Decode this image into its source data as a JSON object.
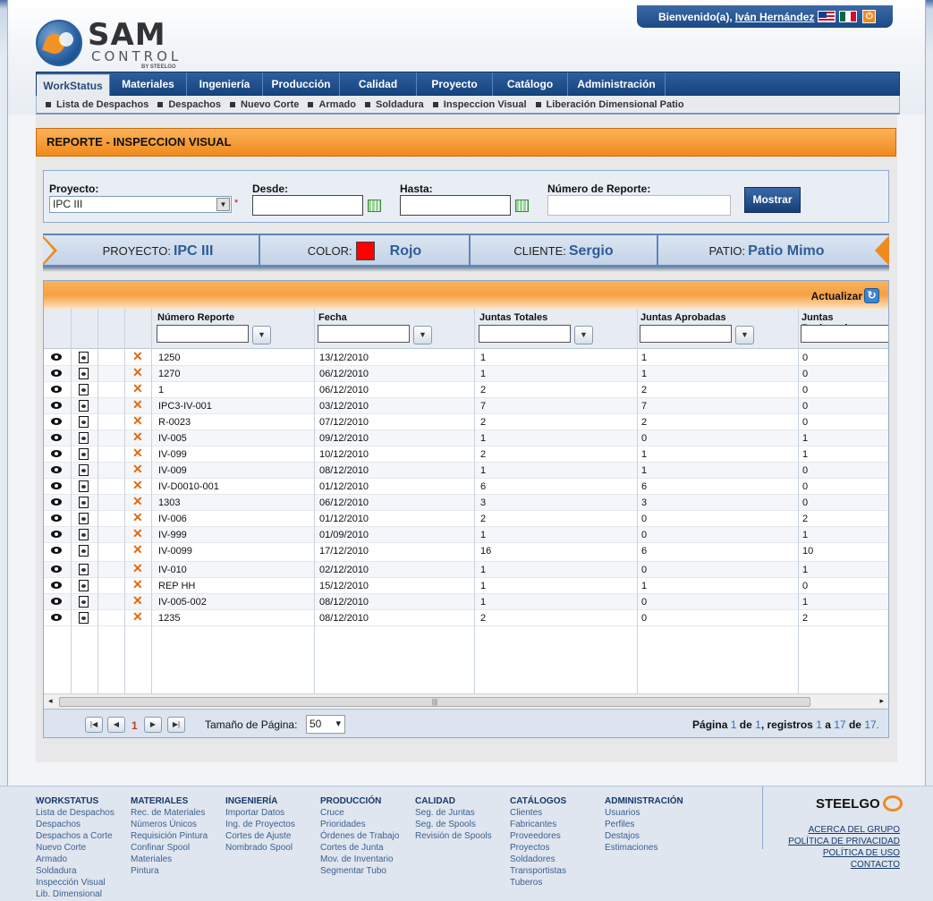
{
  "header": {
    "logo": {
      "main": "SAM",
      "sub": "CONTROL",
      "by": "BY STEELGO"
    },
    "welcome_prefix": "Bienvenido(a),",
    "user_name": "Iván Hernández"
  },
  "nav": {
    "tabs": [
      "WorkStatus",
      "Materiales",
      "Ingeniería",
      "Producción",
      "Calidad",
      "Proyecto",
      "Catálogo",
      "Administración"
    ],
    "active": "WorkStatus"
  },
  "subnav": [
    "Lista de Despachos",
    "Despachos",
    "Nuevo Corte",
    "Armado",
    "Soldadura",
    "Inspeccion Visual",
    "Liberación Dimensional Patio"
  ],
  "page_title": "REPORTE - INSPECCION VISUAL",
  "filters": {
    "proyecto_label": "Proyecto:",
    "proyecto_value": "IPC III",
    "desde_label": "Desde:",
    "hasta_label": "Hasta:",
    "reporte_label": "Número de Reporte:",
    "mostrar_button": "Mostrar"
  },
  "project_banner": {
    "proyecto_label": "PROYECTO:",
    "proyecto_value": "IPC III",
    "color_label": "COLOR:",
    "color_value": "Rojo",
    "color_hex": "#ff0000",
    "cliente_label": "CLIENTE:",
    "cliente_value": "Sergio",
    "patio_label": "PATIO:",
    "patio_value": "Patio Mimo"
  },
  "grid": {
    "refresh_label": "Actualizar",
    "columns": [
      "Número Reporte",
      "Fecha",
      "Juntas Totales",
      "Juntas Aprobadas",
      "Juntas Rechazadas"
    ],
    "rows": [
      [
        "1250",
        "13/12/2010",
        "1",
        "1",
        "0"
      ],
      [
        "1270",
        "06/12/2010",
        "1",
        "1",
        "0"
      ],
      [
        "1",
        "06/12/2010",
        "2",
        "2",
        "0"
      ],
      [
        "IPC3-IV-001",
        "03/12/2010",
        "7",
        "7",
        "0"
      ],
      [
        "R-0023",
        "07/12/2010",
        "2",
        "2",
        "0"
      ],
      [
        "IV-005",
        "09/12/2010",
        "1",
        "0",
        "1"
      ],
      [
        "IV-099",
        "10/12/2010",
        "2",
        "1",
        "1"
      ],
      [
        "IV-009",
        "08/12/2010",
        "1",
        "1",
        "0"
      ],
      [
        "IV-D0010-001",
        "01/12/2010",
        "6",
        "6",
        "0"
      ],
      [
        "1303",
        "06/12/2010",
        "3",
        "3",
        "0"
      ],
      [
        "IV-006",
        "01/12/2010",
        "2",
        "0",
        "2"
      ],
      [
        "IV-999",
        "01/09/2010",
        "1",
        "0",
        "1"
      ],
      [
        "IV-0099",
        "17/12/2010",
        "16",
        "6",
        "10"
      ],
      [
        "IV-010",
        "02/12/2010",
        "1",
        "0",
        "1"
      ],
      [
        "REP HH",
        "15/12/2010",
        "1",
        "1",
        "0"
      ],
      [
        "IV-005-002",
        "08/12/2010",
        "1",
        "0",
        "1"
      ],
      [
        "1235",
        "08/12/2010",
        "2",
        "0",
        "2"
      ]
    ]
  },
  "pager": {
    "current_page": "1",
    "page_size_label": "Tamaño de Página:",
    "page_size": "50",
    "info_prefix": "Página",
    "info_page": "1",
    "info_de": "de",
    "info_pages": "1",
    "info_registros": ", registros",
    "info_from": "1",
    "info_a": "a",
    "info_to": "17",
    "info_de2": "de",
    "info_total": "17."
  },
  "footer": {
    "columns": [
      {
        "title": "WORKSTATUS",
        "links": [
          "Lista de Despachos",
          "Despachos",
          "Despachos a Corte",
          "Nuevo Corte",
          "Armado",
          "Soldadura",
          "Inspección Visual",
          "Lib. Dimensional"
        ]
      },
      {
        "title": "MATERIALES",
        "links": [
          "Rec. de Materiales",
          "Números Únicos",
          "Requisición Pintura",
          "Confinar Spool",
          "Materiales",
          "Pintura"
        ]
      },
      {
        "title": "INGENIERÍA",
        "links": [
          "Importar Datos",
          "Ing. de Proyectos",
          "Cortes de Ajuste",
          "Nombrado Spool"
        ]
      },
      {
        "title": "PRODUCCIÓN",
        "links": [
          "Cruce",
          "Prioridades",
          "Órdenes de Trabajo",
          "Cortes de Junta",
          "Mov. de Inventario",
          "Segmentar Tubo"
        ]
      },
      {
        "title": "CALIDAD",
        "links": [
          "Seg. de Juntas",
          "Seg. de Spools",
          "Revisión de Spools"
        ]
      },
      {
        "title": "CATÁLOGOS",
        "links": [
          "Clientes",
          "Fabricantes",
          "Proveedores",
          "Proyectos",
          "Soldadores",
          "Transportistas",
          "Tuberos"
        ]
      },
      {
        "title": "ADMINISTRACIÓN",
        "links": [
          "Usuarios",
          "Perfiles",
          "Destajos",
          "Estimaciones"
        ]
      }
    ],
    "brand": "STEELGO",
    "right_links": [
      "ACERCA DEL GRUPO",
      "POLÍTICA DE PRIVACIDAD",
      "POLÍTICA DE USO",
      "CONTACTO"
    ]
  }
}
